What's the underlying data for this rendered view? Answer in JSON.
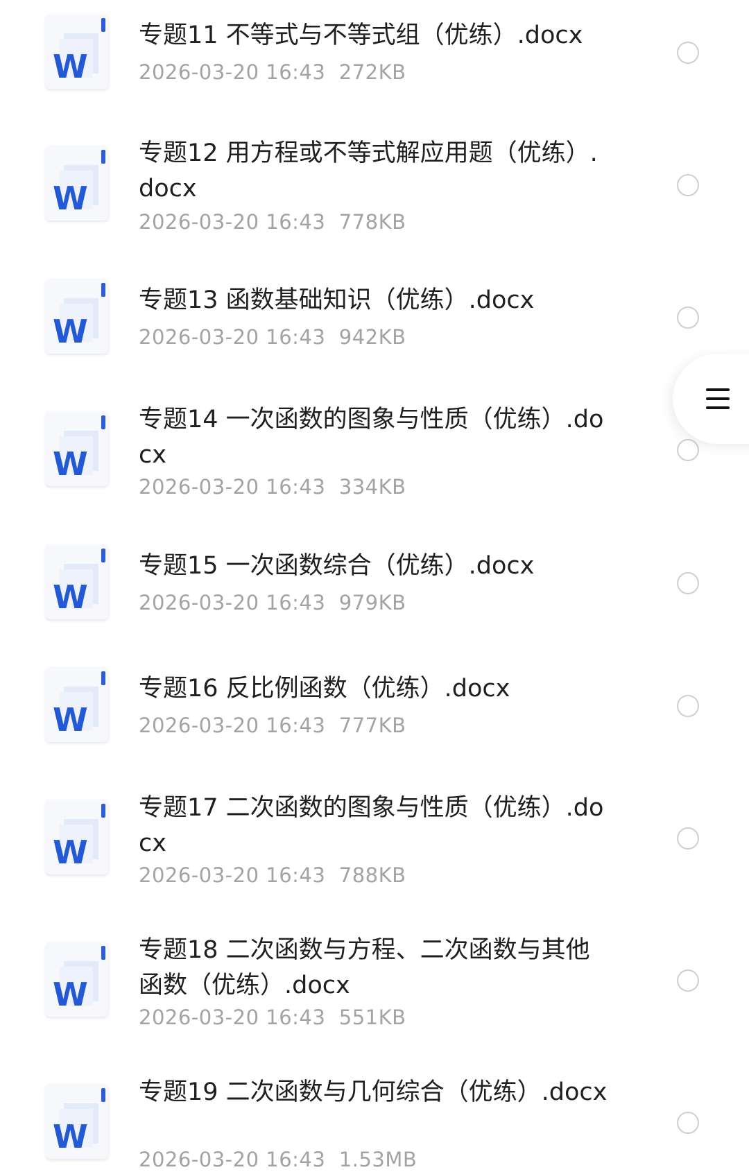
{
  "files": [
    {
      "name": "专题11 不等式与不等式组（优练）.docx",
      "meta": "2026-03-20 16:43  272KB",
      "icon": "word-doc-icon"
    },
    {
      "name": "专题12 用方程或不等式解应用题（优练）.docx",
      "meta": "2026-03-20 16:43  778KB",
      "icon": "word-doc-icon"
    },
    {
      "name": "专题13 函数基础知识（优练）.docx",
      "meta": "2026-03-20 16:43  942KB",
      "icon": "word-doc-icon"
    },
    {
      "name": "专题14 一次函数的图象与性质（优练）.docx",
      "meta": "2026-03-20 16:43  334KB",
      "icon": "word-doc-icon"
    },
    {
      "name": "专题15 一次函数综合（优练）.docx",
      "meta": "2026-03-20 16:43  979KB",
      "icon": "word-doc-icon"
    },
    {
      "name": "专题16 反比例函数（优练）.docx",
      "meta": "2026-03-20 16:43  777KB",
      "icon": "word-doc-icon"
    },
    {
      "name": "专题17 二次函数的图象与性质（优练）.docx",
      "meta": "2026-03-20 16:43  788KB",
      "icon": "word-doc-icon"
    },
    {
      "name": "专题18 二次函数与方程、二次函数与其他函数（优练）.docx",
      "meta": "2026-03-20 16:43  551KB",
      "icon": "word-doc-icon"
    },
    {
      "name": "专题19 二次函数与几何综合（优练）.docx",
      "meta": "2026-03-20 16:43  1.53MB",
      "icon": "word-doc-icon"
    }
  ],
  "icon_letter": "W",
  "floating_menu": {
    "icon": "hamburger-menu-icon"
  },
  "colors": {
    "word_blue": "#2459d4",
    "meta_gray": "#a3a3a3",
    "radio_border": "#cfcfcf"
  }
}
